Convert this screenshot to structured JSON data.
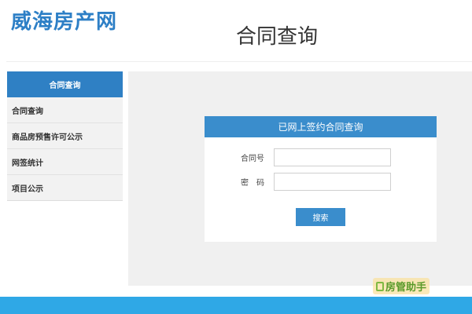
{
  "header": {
    "logo_text": "威海房产网",
    "page_title": "合同查询"
  },
  "sidebar": {
    "header_label": "合同查询",
    "items": [
      {
        "label": "合同查询"
      },
      {
        "label": "商品房预售许可公示"
      },
      {
        "label": "网签统计"
      },
      {
        "label": "项目公示"
      }
    ]
  },
  "panel": {
    "title": "已网上签约合同查询",
    "contract_label": "合同号",
    "contract_value": "",
    "password_label": "密　码",
    "password_value": "",
    "search_label": "搜索"
  },
  "watermark": {
    "text": "房管助手"
  },
  "colors": {
    "brand_blue": "#2d7fc6",
    "panel_blue": "#3a8dcc",
    "footer_blue": "#2fa8e6"
  }
}
